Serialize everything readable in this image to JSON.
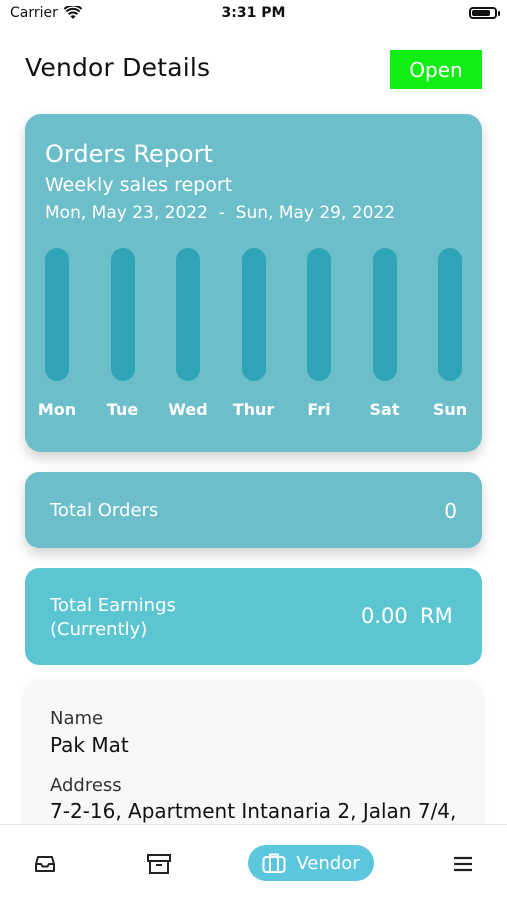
{
  "status_bar": {
    "carrier": "Carrier",
    "time": "3:31 PM",
    "battery_level": 0.9
  },
  "header": {
    "title": "Vendor Details",
    "status_button": "Open",
    "status_color": "#11ee11"
  },
  "report": {
    "title": "Orders Report",
    "subtitle": "Weekly sales report",
    "date_start": "Mon, May 23, 2022",
    "date_separator": "-",
    "date_end": "Sun, May 29, 2022",
    "card_color": "#6cbfca",
    "bar_color": "#2fa4b6"
  },
  "chart_data": {
    "type": "bar",
    "categories": [
      "Mon",
      "Tue",
      "Wed",
      "Thur",
      "Fri",
      "Sat",
      "Sun"
    ],
    "values": [
      0,
      0,
      0,
      0,
      0,
      0,
      0
    ],
    "title": "Orders Report",
    "subtitle": "Weekly sales report",
    "grid": false
  },
  "orders": {
    "label": "Total Orders",
    "value": "0"
  },
  "earnings": {
    "label_line1": "Total Earnings",
    "label_line2": "(Currently)",
    "value": "0.00",
    "currency": "RM",
    "card_color": "#5bc6d2"
  },
  "vendor": {
    "name_label": "Name",
    "name": "Pak Mat",
    "address_label": "Address",
    "address": "7-2-16, Apartment Intanaria 2, Jalan 7/4,"
  },
  "nav": {
    "items": [
      {
        "icon": "inbox-icon"
      },
      {
        "icon": "archive-icon"
      },
      {
        "icon": "briefcase-icon",
        "label": "Vendor",
        "active": true
      },
      {
        "icon": "menu-icon"
      }
    ],
    "accent": "#5cc6dc"
  }
}
